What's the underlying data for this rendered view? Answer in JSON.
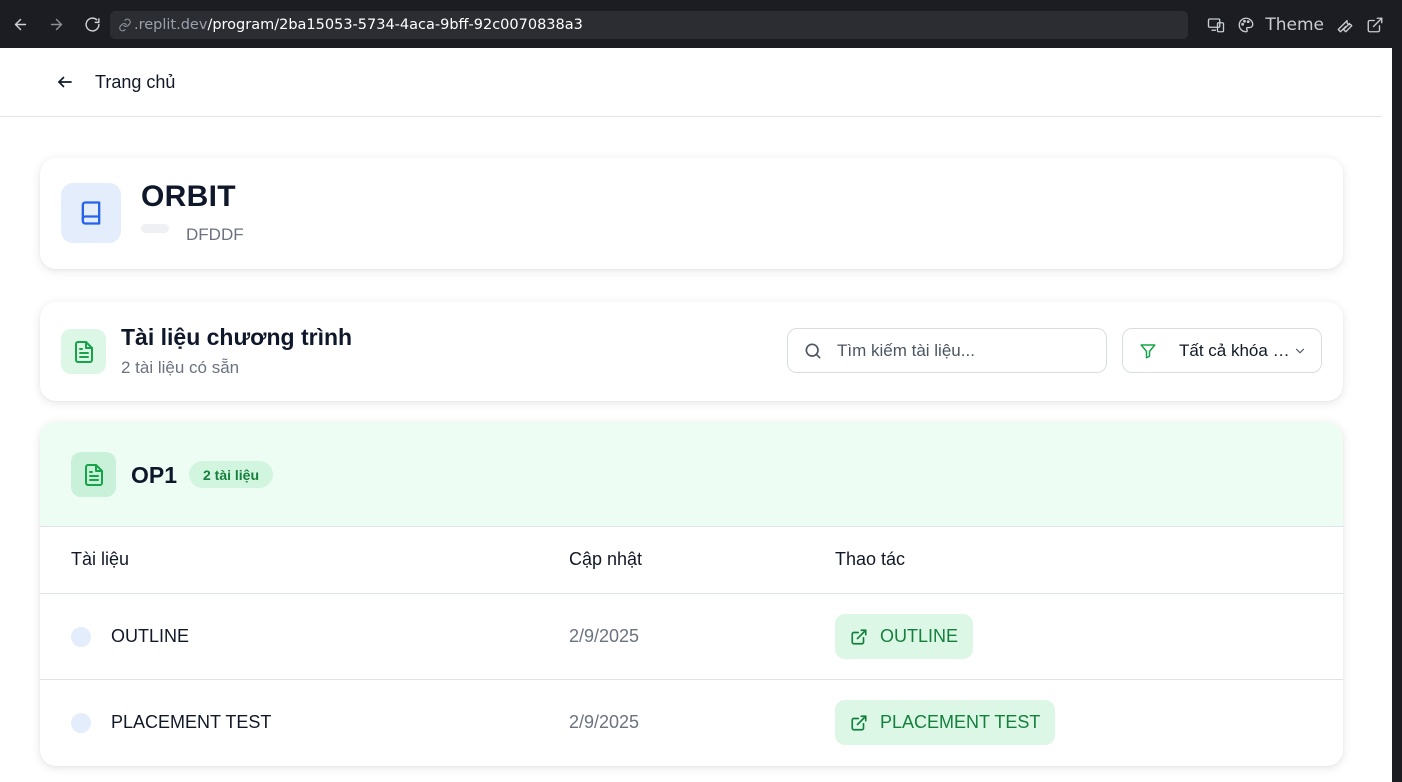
{
  "browser": {
    "url_host": ".replit.dev",
    "url_path": "/program/2ba15053-5734-4aca-9bff-92c0070838a3",
    "theme_label": "Theme"
  },
  "header": {
    "back_label": "Trang chủ"
  },
  "program": {
    "title": "ORBIT",
    "code": "DFDDF",
    "icon": "book-icon"
  },
  "documents": {
    "title": "Tài liệu chương trình",
    "subtitle": "2 tài liệu có sẵn",
    "search_placeholder": "Tìm kiếm tài liệu...",
    "filter_label": "Tất cả khóa học"
  },
  "group": {
    "name": "OP1",
    "badge": "2 tài liệu",
    "columns": [
      "Tài liệu",
      "Cập nhật",
      "Thao tác"
    ],
    "rows": [
      {
        "name": "OUTLINE",
        "date": "2/9/2025",
        "action": "OUTLINE"
      },
      {
        "name": "PLACEMENT TEST",
        "date": "2/9/2025",
        "action": "PLACEMENT TEST"
      }
    ]
  },
  "colors": {
    "accent_green": "#16a34a",
    "accent_blue": "#2563eb",
    "green_tint": "#dcf7e6"
  }
}
